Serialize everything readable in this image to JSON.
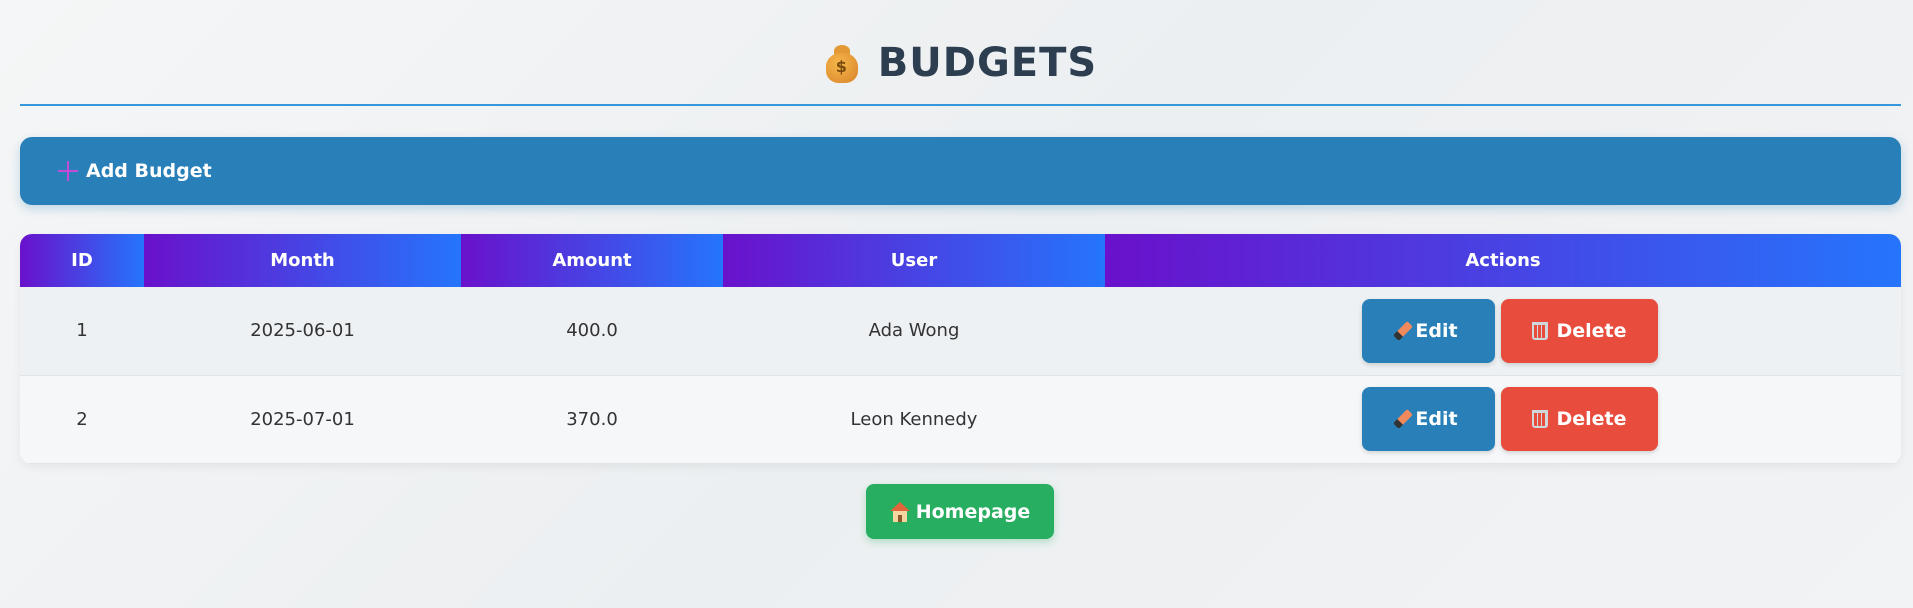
{
  "header": {
    "title": "BUDGETS",
    "icon": "money-bag-icon"
  },
  "add_button": {
    "label": "Add Budget",
    "icon": "plus-icon"
  },
  "table": {
    "columns": [
      "ID",
      "Month",
      "Amount",
      "User",
      "Actions"
    ],
    "rows": [
      {
        "id": "1",
        "month": "2025-06-01",
        "amount": "400.0",
        "user": "Ada Wong"
      },
      {
        "id": "2",
        "month": "2025-07-01",
        "amount": "370.0",
        "user": "Leon Kennedy"
      }
    ],
    "edit_label": "Edit",
    "delete_label": "Delete"
  },
  "home_button": {
    "label": "Homepage",
    "icon": "house-icon"
  },
  "colors": {
    "accent": "#2980b9",
    "danger": "#e74c3c",
    "success": "#27ae60",
    "header_gradient_start": "#6a11cb",
    "header_gradient_end": "#2575fc",
    "title": "#2c3e50"
  }
}
